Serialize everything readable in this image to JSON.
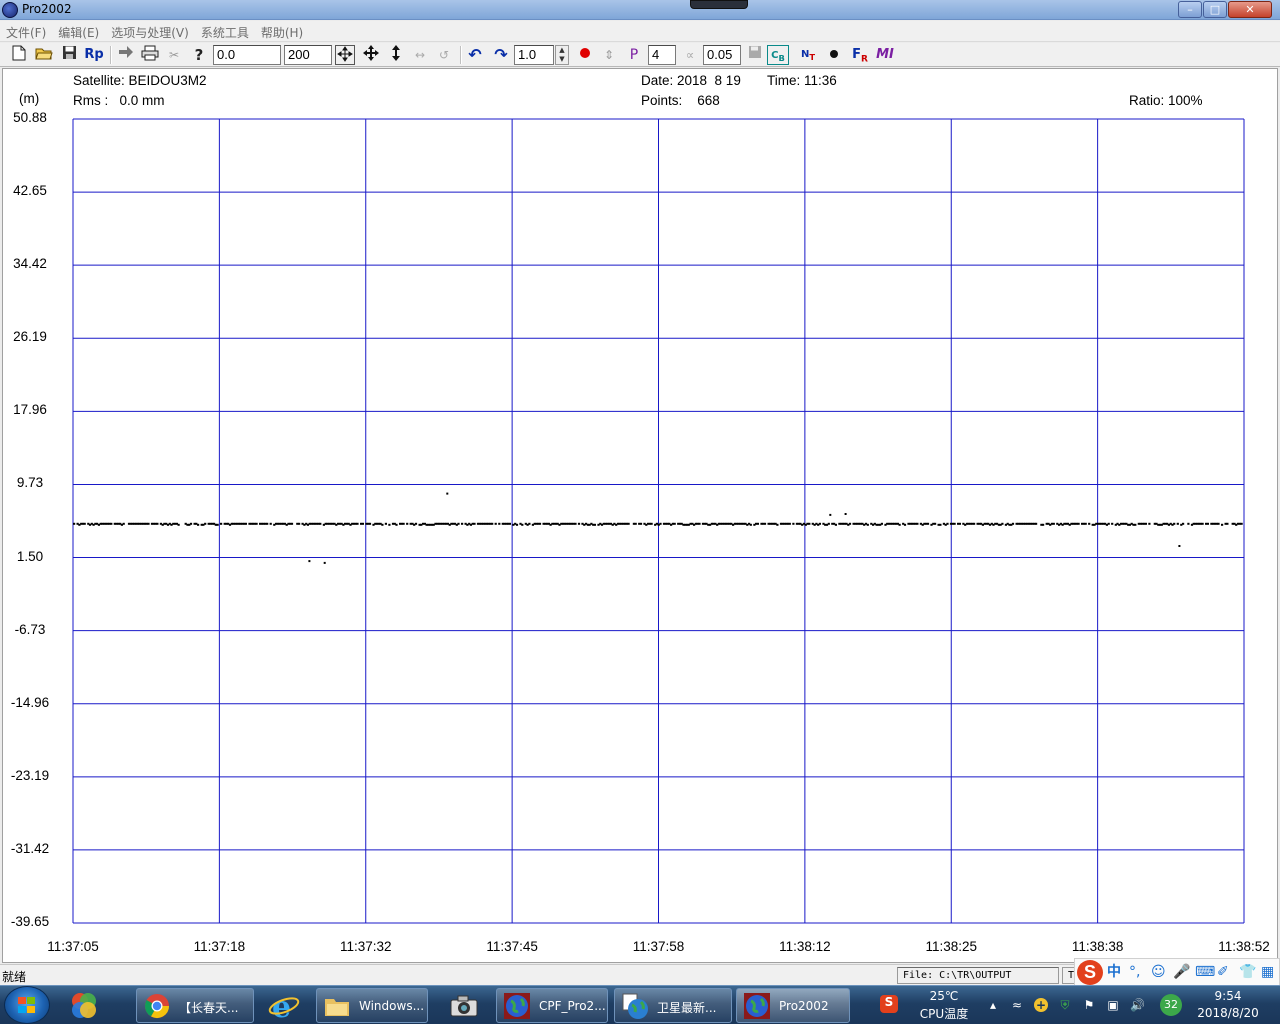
{
  "window": {
    "title": "Pro2002",
    "minimize_label": "–",
    "maximize_label": "□",
    "close_label": "✕"
  },
  "menu": {
    "items": [
      "文件(F)",
      "编辑(E)",
      "选项与处理(V)",
      "系统工具",
      "帮助(H)"
    ]
  },
  "toolbar": {
    "rp_label": "Rp",
    "start_value": "0.0",
    "span_value": "200",
    "scale_value": "1.0",
    "poly_label": "P",
    "poly_value": "4",
    "sigma_value": "0.05",
    "icons": [
      "new-file-icon",
      "open-folder-icon",
      "save-icon",
      "rp-icon",
      "forward-arrow-icon",
      "print-icon",
      "scissors-icon",
      "help-icon",
      "fit-all-icon",
      "move-icon",
      "vertical-resize-icon",
      "horizontal-resize-icon",
      "rotate-icon",
      "undo-icon",
      "redo-icon",
      "red-dot-icon",
      "vertical-arrows-icon",
      "polynomial-icon",
      "cb-icon",
      "nt-icon",
      "dot-icon",
      "fr-icon",
      "mi-icon"
    ]
  },
  "header": {
    "satellite": "Satellite: BEIDOU3M2",
    "rms": "Rms :   0.0 mm",
    "date": "Date: 2018  8 19",
    "time": "Time: 11:36",
    "points": "Points:    668",
    "ratio": "Ratio: 100%",
    "unit": "(m)"
  },
  "chart_data": {
    "type": "scatter",
    "title": "",
    "xlabel": "",
    "ylabel": "(m)",
    "grid": true,
    "ylim": [
      -39.65,
      50.88
    ],
    "yticks": [
      "50.88",
      "42.65",
      "34.42",
      "26.19",
      "17.96",
      "9.73",
      "1.50",
      "-6.73",
      "-14.96",
      "-23.19",
      "-31.42",
      "-39.65"
    ],
    "xticks": [
      "11:37:05",
      "11:37:18",
      "11:37:32",
      "11:37:45",
      "11:37:58",
      "11:38:12",
      "11:38:25",
      "11:38:38",
      "11:38:52"
    ],
    "xlim_seconds_from_first_tick": [
      0,
      107
    ],
    "series": [
      {
        "name": "",
        "baseline_y": 5.3,
        "outliers": [
          {
            "t": 21.6,
            "y": 1.1
          },
          {
            "t": 23.0,
            "y": 0.9
          },
          {
            "t": 34.2,
            "y": 8.7
          },
          {
            "t": 69.2,
            "y": 6.3
          },
          {
            "t": 70.6,
            "y": 6.4
          },
          {
            "t": 101.1,
            "y": 2.8
          }
        ]
      }
    ]
  },
  "statusbar": {
    "status": "就绪",
    "file": "File: C:\\TR\\OUTPUT",
    "t": "T"
  },
  "ime": {
    "logo": "S",
    "zh": "中"
  },
  "taskbar": {
    "tasks": [
      {
        "label": "【长春天..."
      },
      {
        "label": "Windows..."
      },
      {
        "label": "CPF_Pro2..."
      },
      {
        "label": "卫星最新..."
      },
      {
        "label": "Pro2002"
      }
    ],
    "tray": {
      "temperature": "25℃",
      "cpu": "CPU温度",
      "badge": "32",
      "clock_time": "9:54",
      "clock_date": "2018/8/20"
    }
  }
}
